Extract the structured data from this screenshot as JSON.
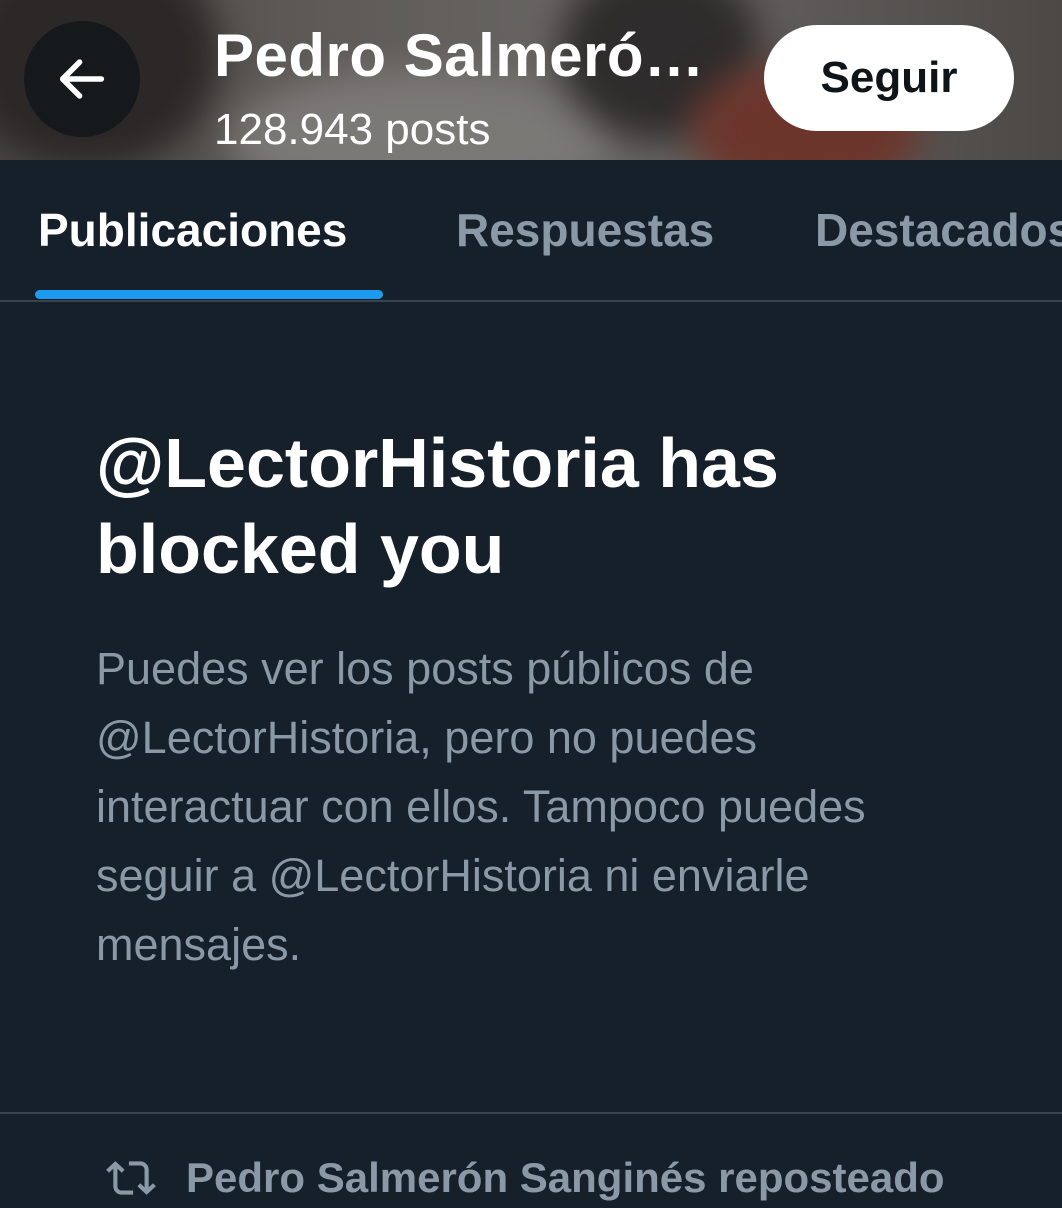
{
  "header": {
    "title": "Pedro Salmeró…",
    "post_count": "128.943 posts",
    "follow_label": "Seguir"
  },
  "tabs": [
    {
      "label": "Publicaciones",
      "active": true
    },
    {
      "label": "Respuestas",
      "active": false
    },
    {
      "label": "Destacados",
      "active": false
    }
  ],
  "blocked": {
    "title": "@LectorHistoria has blocked you",
    "message": "Puedes ver los posts públicos de @LectorHistoria, pero no puedes interactuar con ellos. Tampoco puedes seguir a @LectorHistoria ni enviarle mensajes."
  },
  "repost": {
    "text": "Pedro Salmerón Sanginés reposteado"
  },
  "colors": {
    "background": "#15202b",
    "accent": "#1d9bf0",
    "muted_text": "#8b98a5",
    "divider": "#38444d"
  },
  "icons": {
    "back": "arrow-left-icon",
    "repost": "repost-icon"
  }
}
